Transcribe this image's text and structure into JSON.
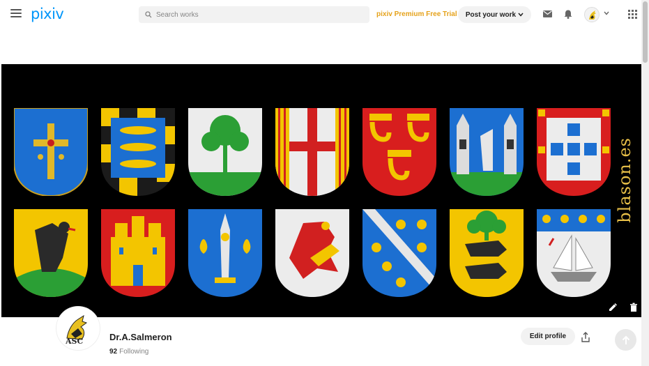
{
  "header": {
    "logo": "pixiv",
    "search_placeholder": "Search works",
    "premium_label": "pixiv Premium Free Trial",
    "post_label": "Post your work"
  },
  "cover": {
    "watermark": "blason.es",
    "shields_row1": [
      "asturias-cross",
      "fish-bordure",
      "tree",
      "quartered-cross",
      "red-gold-cauldrons",
      "twin-towers",
      "portugal-quinas"
    ],
    "shields_row2": [
      "black-wolf",
      "gold-castle",
      "fleur-de-lis-blue",
      "red-lion",
      "bend-fleurs",
      "wolves-tree",
      "ship-fleurs"
    ]
  },
  "profile": {
    "name": "Dr.A.Salmeron",
    "following_count": "92",
    "following_label": "Following",
    "edit_label": "Edit profile"
  },
  "colors": {
    "brand": "#0096fa",
    "premium": "#e5a21b"
  }
}
